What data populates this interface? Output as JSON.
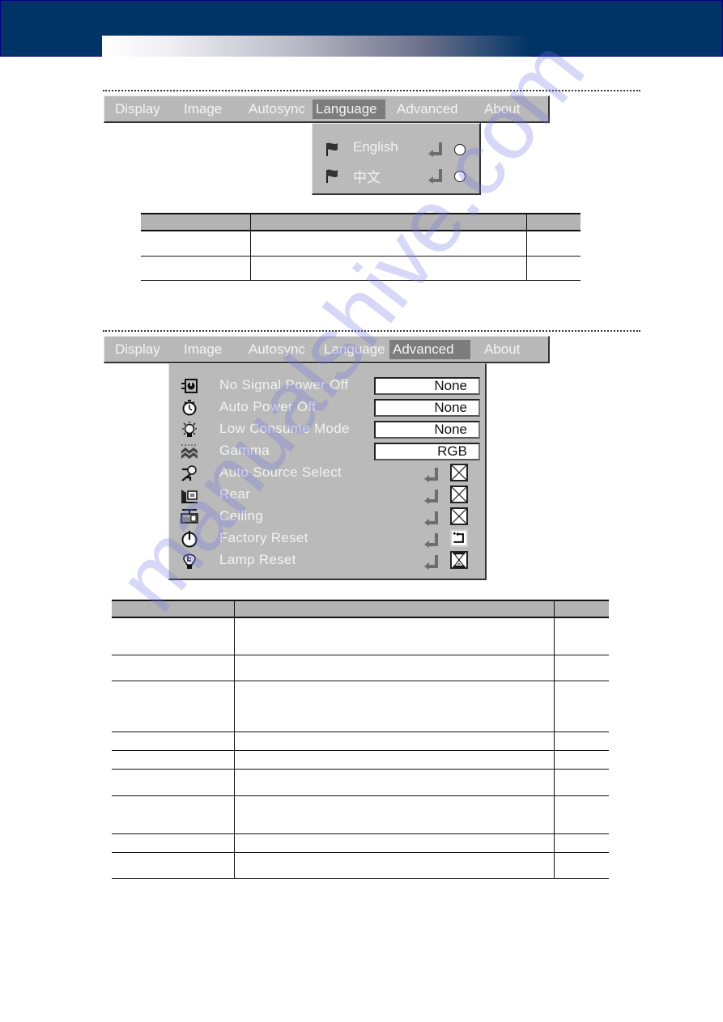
{
  "header": {
    "band_color": "#003366"
  },
  "language_section": {
    "menu_tabs": [
      {
        "label": "Display",
        "active": false
      },
      {
        "label": "Image",
        "active": false
      },
      {
        "label": "Autosync",
        "active": false
      },
      {
        "label": "Language",
        "active": true
      },
      {
        "label": "Advanced",
        "active": false
      },
      {
        "label": "About",
        "active": false
      }
    ],
    "options": [
      {
        "label": "English",
        "icon": "flag-icon",
        "action_icon": "enter-icon",
        "state_icon": "radio-icon",
        "selected": false
      },
      {
        "label": "中文",
        "icon": "flag-icon",
        "action_icon": "enter-icon",
        "state_icon": "radio-icon",
        "selected": false
      }
    ],
    "table": {
      "headers": [
        "",
        "",
        ""
      ],
      "rows": [
        [
          "",
          "",
          ""
        ],
        [
          "",
          "",
          ""
        ]
      ]
    }
  },
  "advanced_section": {
    "menu_tabs": [
      {
        "label": "Display",
        "active": false
      },
      {
        "label": "Image",
        "active": false
      },
      {
        "label": "Autosync",
        "active": false
      },
      {
        "label": "Language",
        "active": false
      },
      {
        "label": "Advanced",
        "active": true
      },
      {
        "label": "About",
        "active": false
      }
    ],
    "items": [
      {
        "label": "No Signal Power Off",
        "icon": "no-signal-power-icon",
        "value": "None"
      },
      {
        "label": "Auto Power Off",
        "icon": "stopwatch-icon",
        "value": "None"
      },
      {
        "label": "Low Consume Mode",
        "icon": "lamp-bulb-icon",
        "value": "None"
      },
      {
        "label": "Gamma",
        "icon": "gamma-wave-icon",
        "value": "RGB"
      },
      {
        "label": "Auto Source Select",
        "icon": "auto-source-icon",
        "action_icon": "enter-icon",
        "state_icon": "checkbox-x-icon"
      },
      {
        "label": "Rear",
        "icon": "rear-projection-icon",
        "action_icon": "enter-icon",
        "state_icon": "checkbox-x-icon"
      },
      {
        "label": "Ceiling",
        "icon": "ceiling-mount-icon",
        "action_icon": "enter-icon",
        "state_icon": "checkbox-x-icon"
      },
      {
        "label": "Factory Reset",
        "icon": "power-icon",
        "action_icon": "enter-icon",
        "state_icon": "reset-icon"
      },
      {
        "label": "Lamp Reset",
        "icon": "lamp-reset-icon",
        "action_icon": "enter-icon",
        "state_icon": "hourglass-icon"
      }
    ],
    "table": {
      "headers": [
        "",
        "",
        ""
      ],
      "rows": [
        [
          "",
          "",
          ""
        ],
        [
          "",
          "",
          ""
        ],
        [
          "",
          "",
          ""
        ],
        [
          "",
          "",
          ""
        ],
        [
          "",
          "",
          ""
        ],
        [
          "",
          "",
          ""
        ],
        [
          "",
          "",
          ""
        ],
        [
          "",
          "",
          ""
        ],
        [
          "",
          "",
          ""
        ]
      ]
    }
  },
  "watermark": "manualshive.com"
}
